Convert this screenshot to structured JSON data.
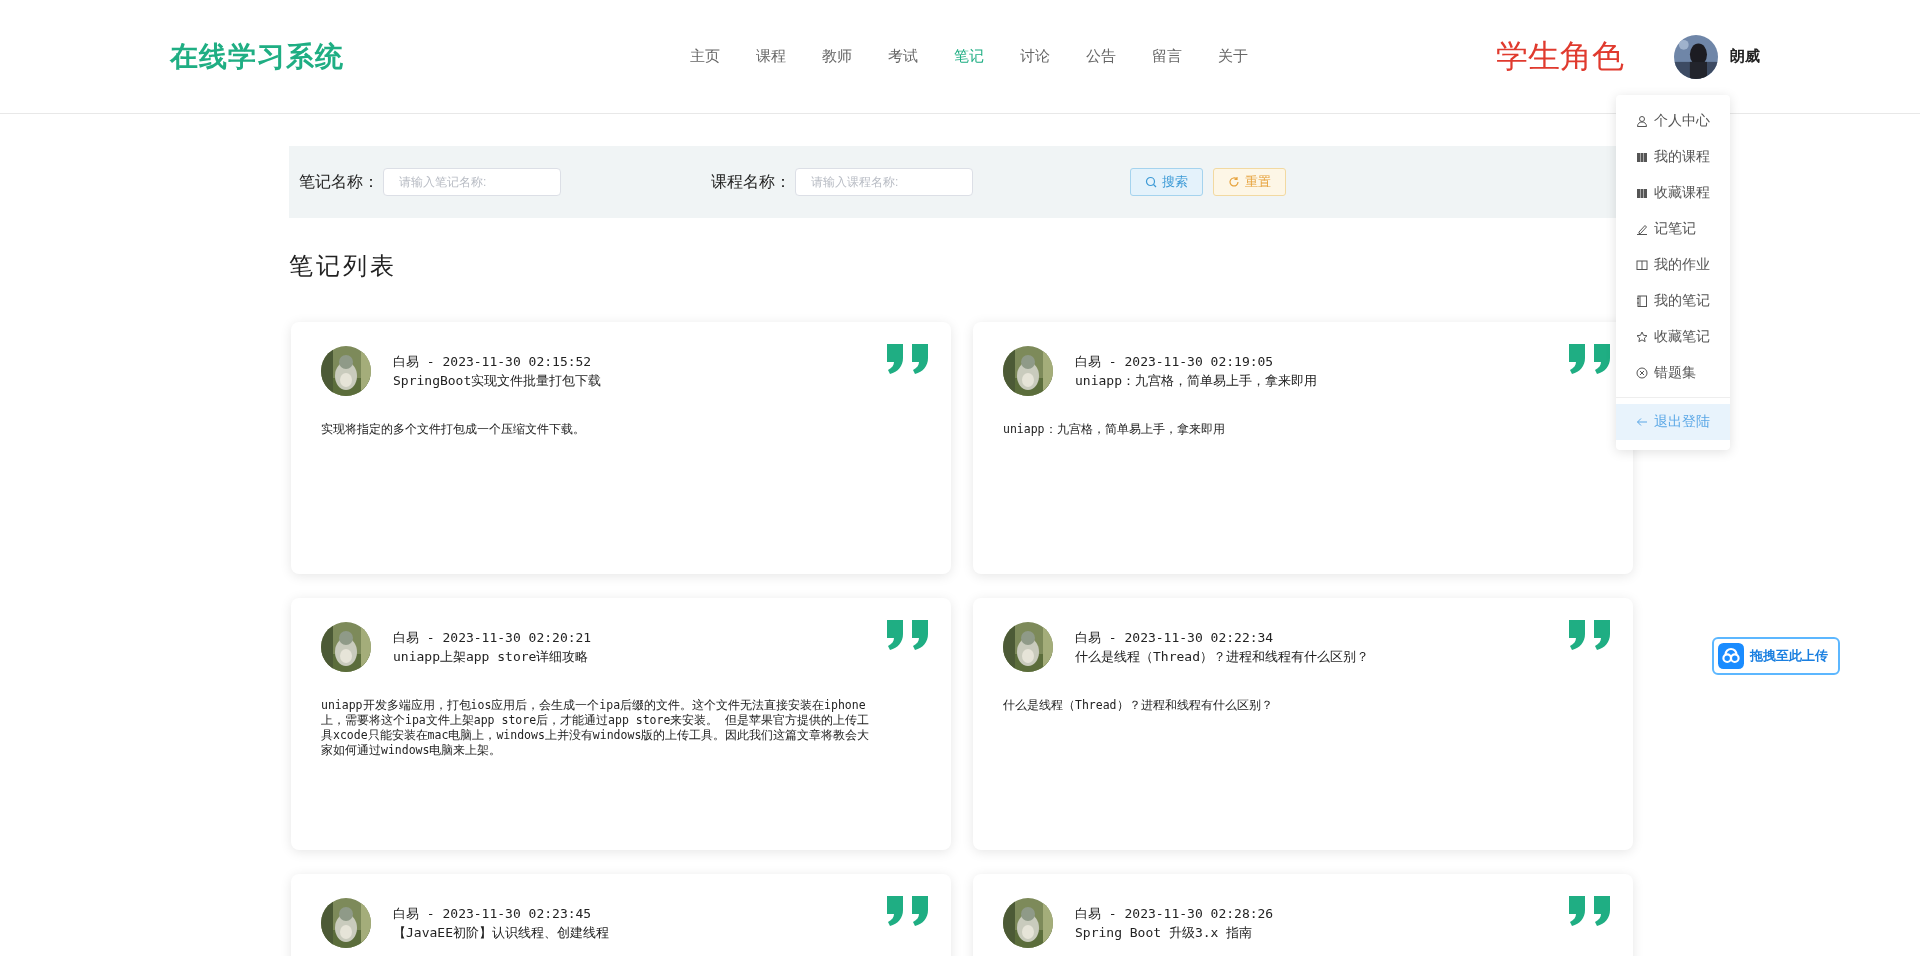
{
  "header": {
    "logo": "在线学习系统",
    "nav": [
      {
        "label": "主页",
        "selected": false
      },
      {
        "label": "课程",
        "selected": false
      },
      {
        "label": "教师",
        "selected": false
      },
      {
        "label": "考试",
        "selected": false
      },
      {
        "label": "笔记",
        "selected": true
      },
      {
        "label": "讨论",
        "selected": false
      },
      {
        "label": "公告",
        "selected": false
      },
      {
        "label": "留言",
        "selected": false
      },
      {
        "label": "关于",
        "selected": false
      }
    ],
    "role": "学生角色",
    "user": "朗威"
  },
  "user_menu": [
    {
      "label": "个人中心",
      "kind": "user",
      "selected": false
    },
    {
      "label": "我的课程",
      "kind": "books",
      "selected": false
    },
    {
      "label": "收藏课程",
      "kind": "books",
      "selected": false
    },
    {
      "label": "记笔记",
      "kind": "pen",
      "selected": false
    },
    {
      "label": "我的作业",
      "kind": "book",
      "selected": false
    },
    {
      "label": "我的笔记",
      "kind": "notebook",
      "selected": false
    },
    {
      "label": "收藏笔记",
      "kind": "star",
      "selected": false
    },
    {
      "label": "错题集",
      "kind": "x",
      "selected": false
    },
    {
      "label": "退出登陆",
      "kind": "back",
      "selected": true,
      "divider": true
    }
  ],
  "search": {
    "fields": [
      {
        "label": "笔记名称：",
        "placeholder": "请输入笔记名称:"
      },
      {
        "label": "课程名称：",
        "placeholder": "请输入课程名称:"
      }
    ],
    "search_button": "搜索",
    "reset_button": "重置"
  },
  "section_title": "笔记列表",
  "notes": [
    {
      "meta": "白易 - 2023-11-30 02:15:52",
      "title": "SpringBoot实现文件批量打包下载",
      "body": "实现将指定的多个文件打包成一个压缩文件下载。"
    },
    {
      "meta": "白易 - 2023-11-30 02:19:05",
      "title": "uniapp：九宫格，简单易上手，拿来即用",
      "body": "uniapp：九宫格，简单易上手，拿来即用"
    },
    {
      "meta": "白易 - 2023-11-30 02:20:21",
      "title": "uniapp上架app store详细攻略",
      "body": "uniapp开发多端应用，打包ios应用后，会生成一个ipa后缀的文件。这个文件无法直接安装在iphone上，需要将这个ipa文件上架app store后，才能通过app store来安装。 但是苹果官方提供的上传工具xcode只能安装在mac电脑上，windows上并没有windows版的上传工具。因此我们这篇文章将教会大家如何通过windows电脑来上架。"
    },
    {
      "meta": "白易 - 2023-11-30 02:22:34",
      "title": "什么是线程（Thread）？进程和线程有什么区别？",
      "body": "什么是线程（Thread）？进程和线程有什么区别？"
    },
    {
      "meta": "白易 - 2023-11-30 02:23:45",
      "title": "【JavaEE初阶】认识线程、创建线程"
    },
    {
      "meta": "白易 - 2023-11-30 02:28:26",
      "title": "Spring Boot 升级3.x 指南"
    }
  ],
  "upload_widget": {
    "label": "拖拽至此上传"
  }
}
